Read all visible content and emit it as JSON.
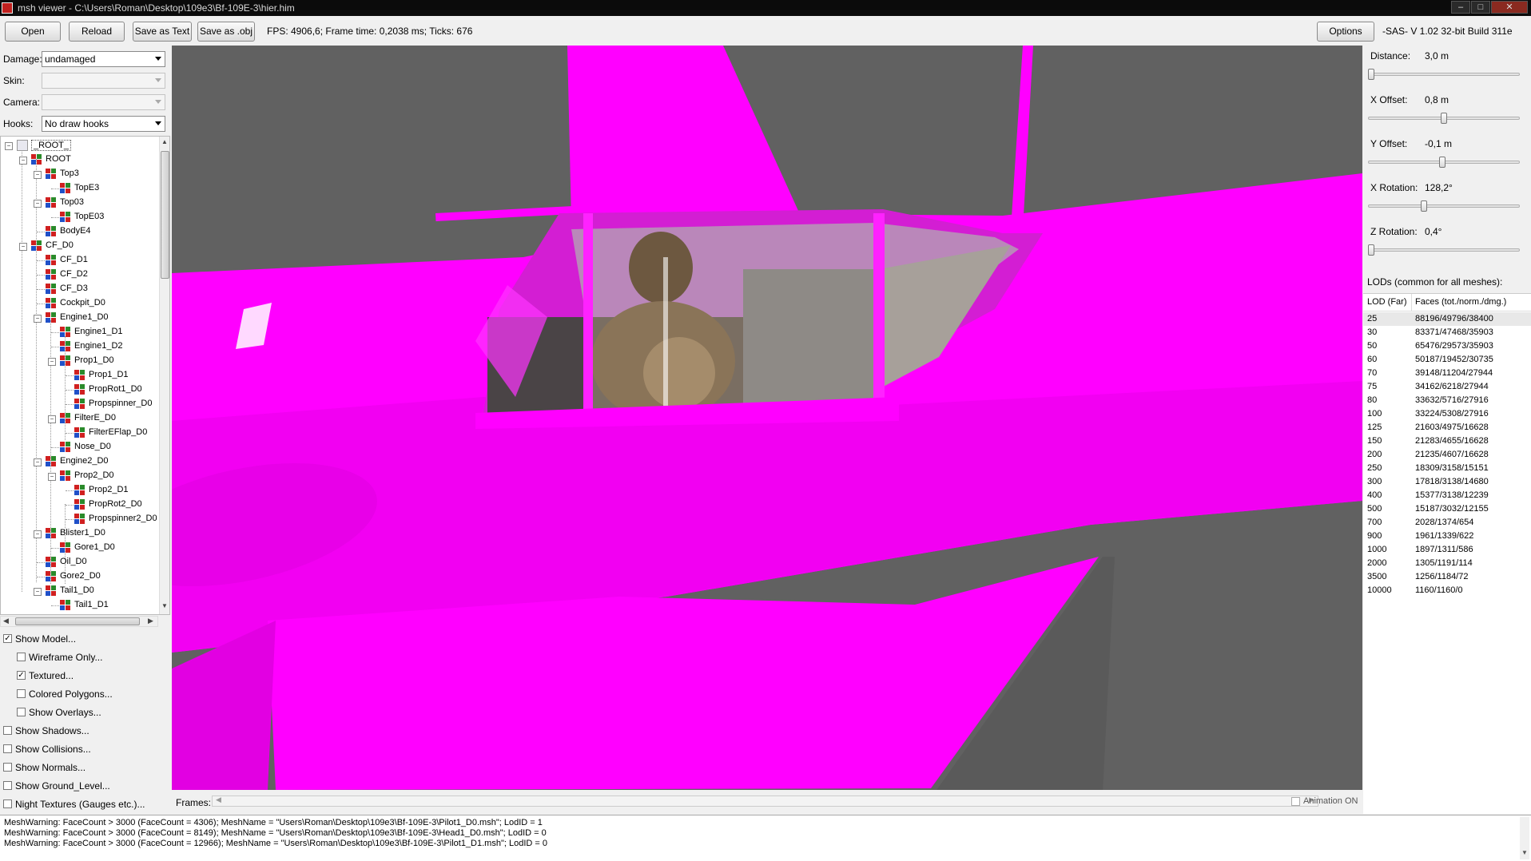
{
  "window": {
    "title": "msh viewer - C:\\Users\\Roman\\Desktop\\109e3\\Bf-109E-3\\hier.him",
    "controls": [
      "–",
      "□",
      "✕"
    ]
  },
  "toolbar": {
    "open_label": "Open",
    "reload_label": "Reload",
    "save_text_label": "Save as Text",
    "save_obj_label": "Save as .obj",
    "stats": "FPS: 4906,6; Frame time: 0,2038 ms; Ticks: 676",
    "options_label": "Options",
    "version": "-SAS- V 1.02  32-bit  Build 311e"
  },
  "left": {
    "damage_label": "Damage:",
    "damage_value": "undamaged",
    "skin_label": "Skin:",
    "skin_value": "",
    "camera_label": "Camera:",
    "camera_value": "",
    "hooks_label": "Hooks:",
    "hooks_value": "No draw hooks"
  },
  "tree": {
    "nodes": [
      {
        "label": "_ROOT_",
        "depth": 0,
        "expander": "−"
      },
      {
        "label": "ROOT",
        "depth": 1,
        "expander": "−"
      },
      {
        "label": "Top3",
        "depth": 2,
        "expander": "−"
      },
      {
        "label": "TopE3",
        "depth": 3,
        "expander": ""
      },
      {
        "label": "Top03",
        "depth": 2,
        "expander": "−"
      },
      {
        "label": "TopE03",
        "depth": 3,
        "expander": ""
      },
      {
        "label": "BodyE4",
        "depth": 2,
        "expander": ""
      },
      {
        "label": "CF_D0",
        "depth": 1,
        "expander": "−"
      },
      {
        "label": "CF_D1",
        "depth": 2,
        "expander": ""
      },
      {
        "label": "CF_D2",
        "depth": 2,
        "expander": ""
      },
      {
        "label": "CF_D3",
        "depth": 2,
        "expander": ""
      },
      {
        "label": "Cockpit_D0",
        "depth": 2,
        "expander": ""
      },
      {
        "label": "Engine1_D0",
        "depth": 2,
        "expander": "−"
      },
      {
        "label": "Engine1_D1",
        "depth": 3,
        "expander": ""
      },
      {
        "label": "Engine1_D2",
        "depth": 3,
        "expander": ""
      },
      {
        "label": "Prop1_D0",
        "depth": 3,
        "expander": "−"
      },
      {
        "label": "Prop1_D1",
        "depth": 4,
        "expander": ""
      },
      {
        "label": "PropRot1_D0",
        "depth": 4,
        "expander": ""
      },
      {
        "label": "Propspinner_D0",
        "depth": 4,
        "expander": ""
      },
      {
        "label": "FilterE_D0",
        "depth": 3,
        "expander": "−"
      },
      {
        "label": "FilterEFlap_D0",
        "depth": 4,
        "expander": ""
      },
      {
        "label": "Nose_D0",
        "depth": 3,
        "expander": ""
      },
      {
        "label": "Engine2_D0",
        "depth": 2,
        "expander": "−"
      },
      {
        "label": "Prop2_D0",
        "depth": 3,
        "expander": "−"
      },
      {
        "label": "Prop2_D1",
        "depth": 4,
        "expander": ""
      },
      {
        "label": "PropRot2_D0",
        "depth": 4,
        "expander": ""
      },
      {
        "label": "Propspinner2_D0",
        "depth": 4,
        "expander": ""
      },
      {
        "label": "Blister1_D0",
        "depth": 2,
        "expander": "−"
      },
      {
        "label": "Gore1_D0",
        "depth": 3,
        "expander": ""
      },
      {
        "label": "Oil_D0",
        "depth": 2,
        "expander": ""
      },
      {
        "label": "Gore2_D0",
        "depth": 2,
        "expander": ""
      },
      {
        "label": "Tail1_D0",
        "depth": 2,
        "expander": "−"
      },
      {
        "label": "Tail1_D1",
        "depth": 3,
        "expander": ""
      }
    ]
  },
  "checkboxes": [
    {
      "label": "Show Model...",
      "checked": true,
      "indent": 0
    },
    {
      "label": "Wireframe Only...",
      "checked": false,
      "indent": 1
    },
    {
      "label": "Textured...",
      "checked": true,
      "indent": 1
    },
    {
      "label": "Colored Polygons...",
      "checked": false,
      "indent": 1
    },
    {
      "label": "Show Overlays...",
      "checked": false,
      "indent": 1
    },
    {
      "label": "Show Shadows...",
      "checked": false,
      "indent": 0
    },
    {
      "label": "Show Collisions...",
      "checked": false,
      "indent": 0
    },
    {
      "label": "Show Normals...",
      "checked": false,
      "indent": 0
    },
    {
      "label": "Show Ground_Level...",
      "checked": false,
      "indent": 0
    },
    {
      "label": "Night Textures (Gauges etc.)...",
      "checked": false,
      "indent": 0
    }
  ],
  "right": {
    "sliders": [
      {
        "label": "Distance:",
        "value": "3,0 m",
        "fraction": 0.0
      },
      {
        "label": "X Offset:",
        "value": "0,8 m",
        "fraction": 0.5
      },
      {
        "label": "Y Offset:",
        "value": "-0,1 m",
        "fraction": 0.49
      },
      {
        "label": "X Rotation:",
        "value": "128,2°",
        "fraction": 0.36
      },
      {
        "label": "Z Rotation:",
        "value": "0,4°",
        "fraction": 0.0
      }
    ],
    "lods_title": "LODs (common for all meshes):",
    "lod_header_far": "LOD (Far)",
    "lod_header_faces": "Faces (tot./norm./dmg.)",
    "lod_rows": [
      {
        "far": "25",
        "faces": "88196/49796/38400"
      },
      {
        "far": "30",
        "faces": "83371/47468/35903"
      },
      {
        "far": "50",
        "faces": "65476/29573/35903"
      },
      {
        "far": "60",
        "faces": "50187/19452/30735"
      },
      {
        "far": "70",
        "faces": "39148/11204/27944"
      },
      {
        "far": "75",
        "faces": "34162/6218/27944"
      },
      {
        "far": "80",
        "faces": "33632/5716/27916"
      },
      {
        "far": "100",
        "faces": "33224/5308/27916"
      },
      {
        "far": "125",
        "faces": "21603/4975/16628"
      },
      {
        "far": "150",
        "faces": "21283/4655/16628"
      },
      {
        "far": "200",
        "faces": "21235/4607/16628"
      },
      {
        "far": "250",
        "faces": "18309/3158/15151"
      },
      {
        "far": "300",
        "faces": "17818/3138/14680"
      },
      {
        "far": "400",
        "faces": "15377/3138/12239"
      },
      {
        "far": "500",
        "faces": "15187/3032/12155"
      },
      {
        "far": "700",
        "faces": "2028/1374/654"
      },
      {
        "far": "900",
        "faces": "1961/1339/622"
      },
      {
        "far": "1000",
        "faces": "1897/1311/586"
      },
      {
        "far": "2000",
        "faces": "1305/1191/114"
      },
      {
        "far": "3500",
        "faces": "1256/1184/72"
      },
      {
        "far": "10000",
        "faces": "1160/1160/0"
      }
    ]
  },
  "frames": {
    "label": "Frames:",
    "animation_label": "Animation ON",
    "animation_checked": false
  },
  "log": [
    "MeshWarning: FaceCount > 3000 (FaceCount = 4306); MeshName = \"Users\\Roman\\Desktop\\109e3\\Bf-109E-3\\Pilot1_D0.msh\"; LodID = 1",
    "MeshWarning: FaceCount > 3000 (FaceCount = 8149); MeshName = \"Users\\Roman\\Desktop\\109e3\\Bf-109E-3\\Head1_D0.msh\"; LodID = 0",
    "MeshWarning: FaceCount > 3000 (FaceCount = 12966); MeshName = \"Users\\Roman\\Desktop\\109e3\\Bf-109E-3\\Pilot1_D1.msh\"; LodID = 0"
  ],
  "colors": {
    "model_magenta": "#ff00ff",
    "viewport_bg": "#616161"
  }
}
